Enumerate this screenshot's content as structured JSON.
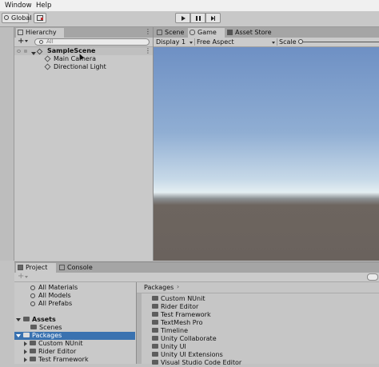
{
  "menu": {
    "window": "Window",
    "help": "Help"
  },
  "toolbar": {
    "global": "Global"
  },
  "hierarchy": {
    "tab_label": "Hierarchy",
    "add_label": "+",
    "search_placeholder": "All",
    "scene_name": "SampleScene",
    "items": [
      "Main Camera",
      "Directional Light"
    ]
  },
  "scene_tabs": {
    "scene": "Scene",
    "game": "Game",
    "asset_store": "Asset Store"
  },
  "game_toolbar": {
    "display": "Display 1",
    "aspect": "Free Aspect",
    "scale": "Scale"
  },
  "project": {
    "tab_project": "Project",
    "tab_console": "Console",
    "add_label": "+",
    "favorites": [
      "All Materials",
      "All Models",
      "All Prefabs"
    ],
    "assets_label": "Assets",
    "scenes_label": "Scenes",
    "packages_label": "Packages",
    "package_children": [
      "Custom NUnit",
      "Rider Editor",
      "Test Framework"
    ],
    "breadcrumb": "Packages",
    "package_list": [
      "Custom NUnit",
      "Rider Editor",
      "Test Framework",
      "TextMesh Pro",
      "Timeline",
      "Unity Collaborate",
      "Unity UI",
      "Unity UI Extensions",
      "Visual Studio Code Editor"
    ]
  },
  "colors": {
    "sky_top": "#6d8fc3",
    "horizon": "#d9e6ee",
    "ground": "#6a625d",
    "selection": "#3a72b0"
  }
}
